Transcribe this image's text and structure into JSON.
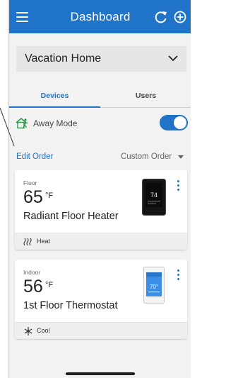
{
  "header": {
    "title": "Dashboard"
  },
  "home_selector": {
    "selected": "Vacation Home"
  },
  "tabs": [
    {
      "label": "Devices",
      "active": true
    },
    {
      "label": "Users",
      "active": false
    }
  ],
  "away_mode": {
    "label": "Away Mode",
    "enabled": true
  },
  "order": {
    "edit_label": "Edit Order",
    "sort_label": "Custom Order"
  },
  "devices": [
    {
      "zone": "Floor",
      "temperature": "65",
      "unit": "°F",
      "name": "Radiant Floor Heater",
      "mode": "Heat",
      "screen_value": "74"
    },
    {
      "zone": "Indoor",
      "temperature": "56",
      "unit": "°F",
      "name": "1st Floor Thermostat",
      "mode": "Cool",
      "screen_value": "70°"
    }
  ],
  "colors": {
    "accent": "#1f73c8",
    "background": "#f2f2f2",
    "card": "#ffffff",
    "footer": "#efefef"
  },
  "icons": {
    "menu": "hamburger-icon",
    "refresh": "refresh-icon",
    "add": "add-circle-icon",
    "away": "away-person-house-icon",
    "heat": "heat-waves-icon",
    "cool": "snowflake-icon"
  }
}
